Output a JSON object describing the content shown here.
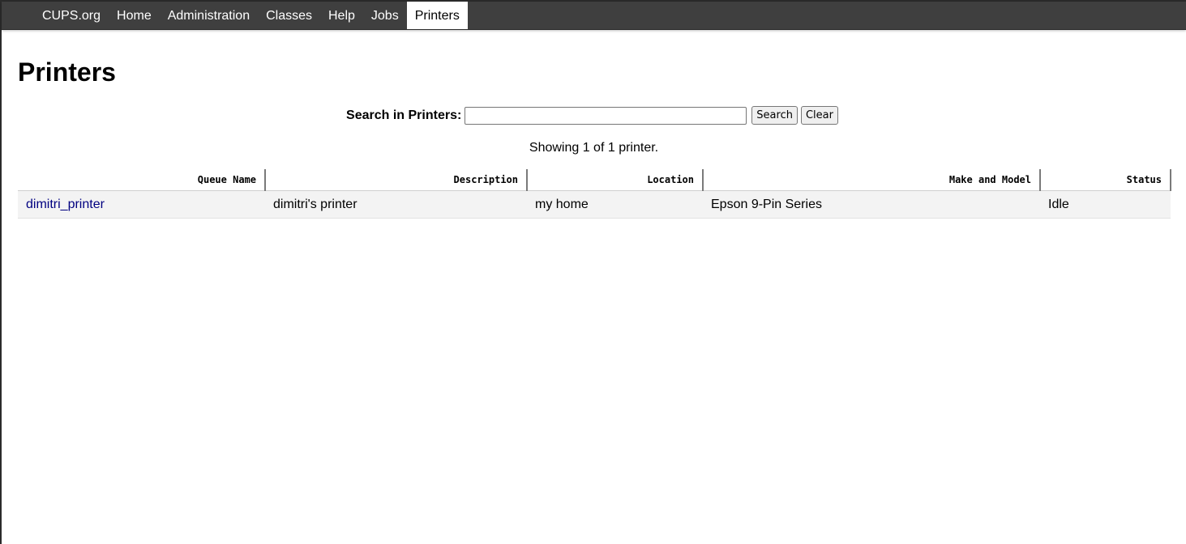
{
  "nav": {
    "items": [
      {
        "label": "CUPS.org"
      },
      {
        "label": "Home"
      },
      {
        "label": "Administration"
      },
      {
        "label": "Classes"
      },
      {
        "label": "Help"
      },
      {
        "label": "Jobs"
      },
      {
        "label": "Printers"
      }
    ],
    "active": "Printers"
  },
  "page": {
    "title": "Printers"
  },
  "search": {
    "label": "Search in Printers:",
    "value": "",
    "search_button": "Search",
    "clear_button": "Clear"
  },
  "showing_text": "Showing 1 of 1 printer.",
  "table": {
    "columns": [
      "Queue Name",
      "Description",
      "Location",
      "Make and Model",
      "Status"
    ],
    "rows": [
      {
        "queue_name": "dimitri_printer",
        "description": "dimitri's printer",
        "location": "my home",
        "make_model": "Epson 9-Pin Series",
        "status": "Idle"
      }
    ]
  },
  "colors": {
    "navbar": "#3f3f3f",
    "link": "#000080",
    "row_bg": "#f3f3f3"
  }
}
